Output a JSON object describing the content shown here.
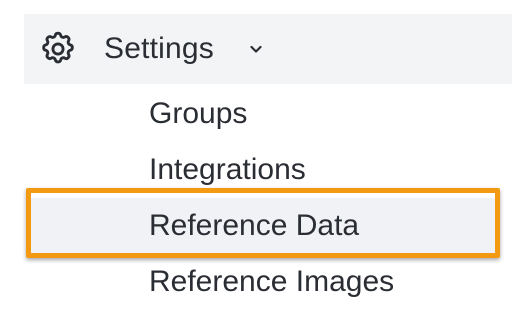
{
  "settings": {
    "label": "Settings",
    "icon": "gear-icon",
    "expand_icon": "chevron-down-icon",
    "items": [
      {
        "label": "Groups"
      },
      {
        "label": "Integrations"
      },
      {
        "label": "Reference Data",
        "active": true
      },
      {
        "label": "Reference Images"
      }
    ]
  },
  "colors": {
    "highlight_border": "#f39a12",
    "header_background": "#f3f4f6",
    "text": "#2a2d33"
  }
}
